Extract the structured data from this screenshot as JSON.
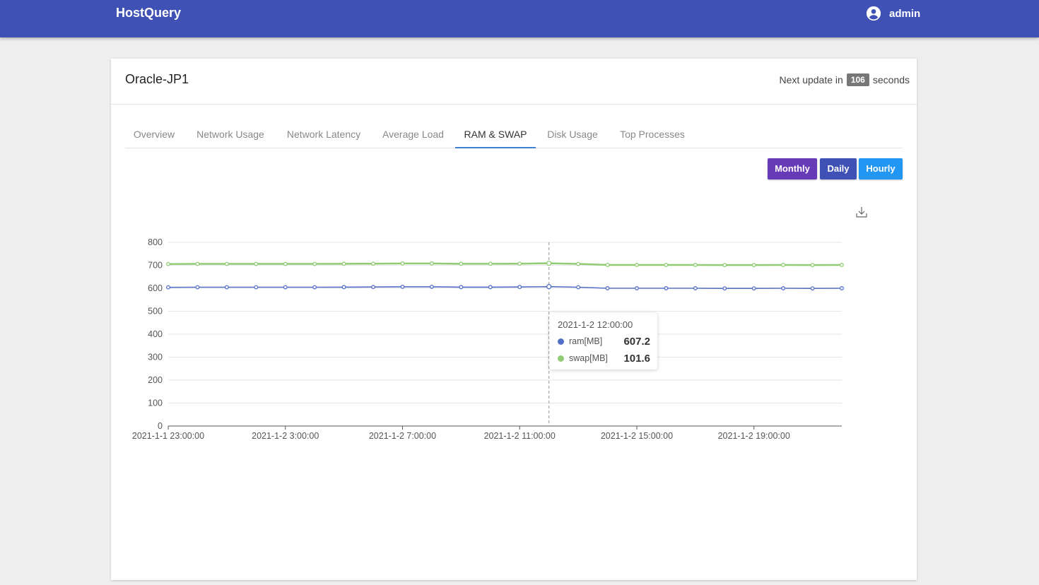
{
  "app": {
    "brand": "HostQuery",
    "user": "admin"
  },
  "host": {
    "name": "Oracle-JP1",
    "next_update_prefix": "Next update in",
    "next_update_seconds": "106",
    "next_update_suffix": "seconds"
  },
  "tabs": [
    {
      "label": "Overview",
      "active": false
    },
    {
      "label": "Network Usage",
      "active": false
    },
    {
      "label": "Network Latency",
      "active": false
    },
    {
      "label": "Average Load",
      "active": false
    },
    {
      "label": "RAM & SWAP",
      "active": true
    },
    {
      "label": "Disk Usage",
      "active": false
    },
    {
      "label": "Top Processes",
      "active": false
    }
  ],
  "range_buttons": {
    "monthly": "Monthly",
    "daily": "Daily",
    "hourly": "Hourly"
  },
  "colors": {
    "header": "#3f51b5",
    "monthly": "#673ab7",
    "daily": "#3f51b5",
    "hourly": "#2196f3",
    "ram": "#5470c6",
    "swap": "#91cc75"
  },
  "icons": {
    "user": "account-circle-icon",
    "download": "download-icon"
  },
  "chart_data": {
    "type": "area",
    "stacked": true,
    "x": [
      "2021-1-1 23:00:00",
      "2021-1-2 0:00:00",
      "2021-1-2 1:00:00",
      "2021-1-2 2:00:00",
      "2021-1-2 3:00:00",
      "2021-1-2 4:00:00",
      "2021-1-2 5:00:00",
      "2021-1-2 6:00:00",
      "2021-1-2 7:00:00",
      "2021-1-2 8:00:00",
      "2021-1-2 9:00:00",
      "2021-1-2 10:00:00",
      "2021-1-2 11:00:00",
      "2021-1-2 12:00:00",
      "2021-1-2 13:00:00",
      "2021-1-2 14:00:00",
      "2021-1-2 15:00:00",
      "2021-1-2 16:00:00",
      "2021-1-2 17:00:00",
      "2021-1-2 18:00:00",
      "2021-1-2 19:00:00",
      "2021-1-2 20:00:00",
      "2021-1-2 21:00:00",
      "2021-1-2 22:00:00"
    ],
    "xtick_labels": [
      "2021-1-1 23:00:00",
      "2021-1-2 3:00:00",
      "2021-1-2 7:00:00",
      "2021-1-2 11:00:00",
      "2021-1-2 15:00:00",
      "2021-1-2 19:00:00"
    ],
    "series": [
      {
        "name": "ram[MB]",
        "values": [
          604,
          604.5,
          604.5,
          604.5,
          604.5,
          604.5,
          605,
          605.5,
          606.5,
          606.5,
          605,
          605,
          605.5,
          607.2,
          604.5,
          600,
          600,
          600,
          600,
          599.5,
          599.5,
          600,
          599.5,
          600
        ]
      },
      {
        "name": "swap[MB]",
        "values": [
          101.6,
          101.6,
          101.6,
          101.6,
          101.6,
          101.6,
          101.6,
          101.6,
          101.6,
          101.6,
          101.6,
          101.6,
          101.6,
          101.6,
          101.6,
          101.6,
          101.6,
          101.6,
          101.6,
          101.6,
          101.6,
          101.6,
          101.6,
          101.6
        ]
      }
    ],
    "ylim": [
      0,
      800
    ],
    "yticks": [
      0,
      100,
      200,
      300,
      400,
      500,
      600,
      700,
      800
    ],
    "grid": true,
    "tooltip": {
      "title": "2021-1-2 12:00:00",
      "index": 13,
      "rows": [
        {
          "name": "ram[MB]",
          "value": "607.2"
        },
        {
          "name": "swap[MB]",
          "value": "101.6"
        }
      ]
    }
  }
}
